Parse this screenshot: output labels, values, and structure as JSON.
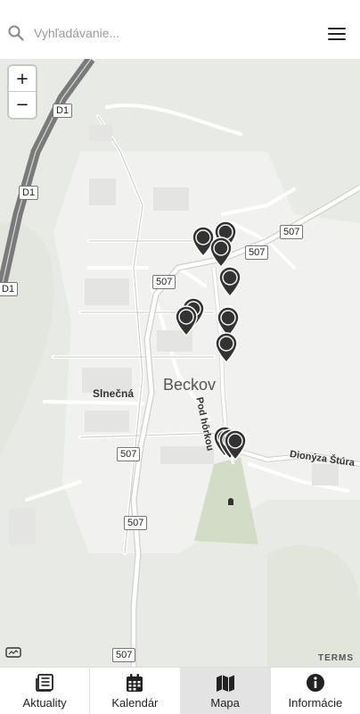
{
  "search": {
    "placeholder": "Vyhľadávanie..."
  },
  "map": {
    "place_name": "Beckov",
    "streets": [
      "Slnečná",
      "Pod hôrkou",
      "Dionýza Štúra"
    ],
    "road_shields": [
      "D1",
      "D1",
      "D1",
      "507",
      "507",
      "507",
      "507",
      "507",
      "507"
    ],
    "zoom_in": "+",
    "zoom_out": "−",
    "terms": "TERMS",
    "marker_count": 13
  },
  "tabs": [
    {
      "label": "Aktuality",
      "icon": "newspaper-icon",
      "active": false
    },
    {
      "label": "Kalendár",
      "icon": "calendar-icon",
      "active": false
    },
    {
      "label": "Mapa",
      "icon": "map-icon",
      "active": true
    },
    {
      "label": "Informácie",
      "icon": "info-icon",
      "active": false
    }
  ],
  "colors": {
    "marker": "#333333",
    "active_tab": "#e3e3e3",
    "park": "#d3dcc6"
  }
}
